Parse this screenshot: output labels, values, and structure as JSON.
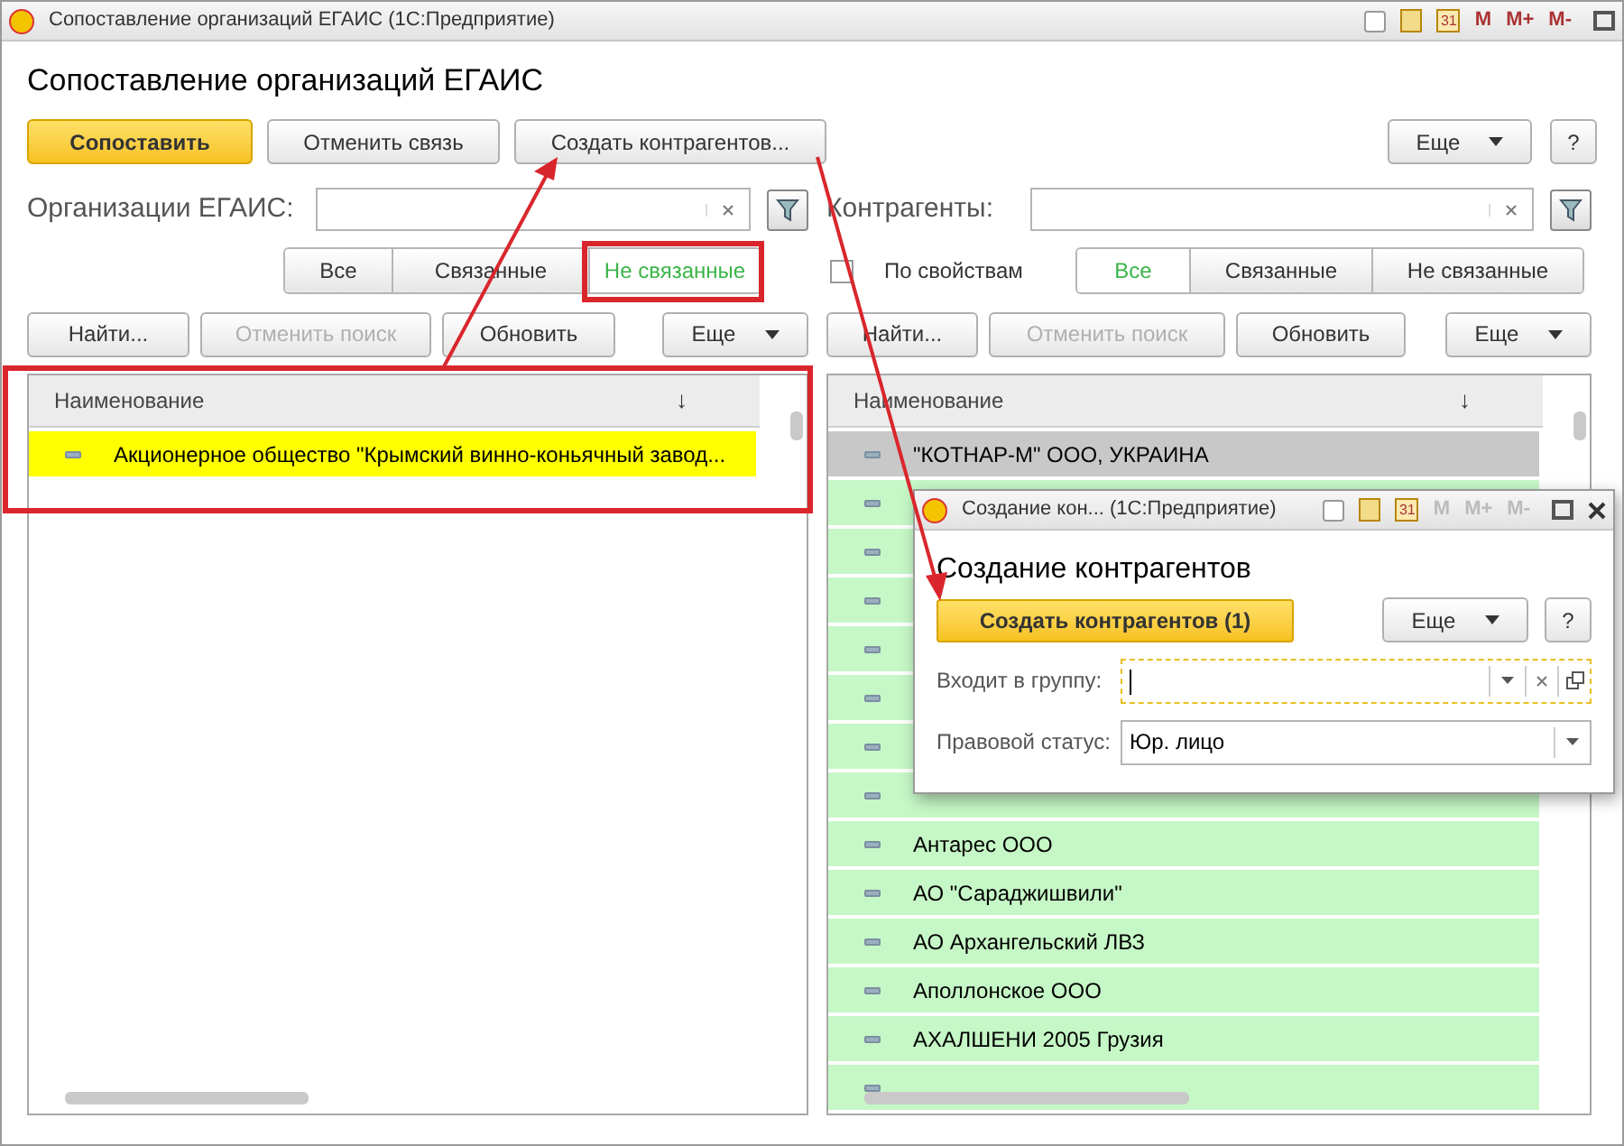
{
  "window": {
    "title": "Сопоставление организаций ЕГАИС  (1С:Предприятие)",
    "calendar_day": "31",
    "memory_buttons": [
      "M",
      "M+",
      "M-"
    ]
  },
  "form": {
    "heading": "Сопоставление организаций ЕГАИС",
    "buttons": [
      {
        "label": "Сопоставить",
        "kind": "primary"
      },
      {
        "label": "Отменить связь",
        "kind": "normal"
      },
      {
        "label": "Создать контрагентов...",
        "kind": "normal"
      }
    ],
    "more": "Еще",
    "help": "?"
  },
  "left": {
    "search_label": "Организации ЕГАИС:",
    "filter": [
      {
        "label": "Все",
        "selected": false
      },
      {
        "label": "Связанные",
        "selected": false
      },
      {
        "label": "Не связанные",
        "selected": true
      }
    ],
    "buttons": [
      {
        "label": "Найти...",
        "disabled": false
      },
      {
        "label": "Отменить поиск",
        "disabled": true
      },
      {
        "label": "Обновить",
        "disabled": false
      }
    ],
    "more": "Еще",
    "table": {
      "columns": [
        "Наименование"
      ],
      "sort_mark": "↓",
      "rows": [
        {
          "name": "Акционерное общество \"Крымский винно-коньячный завод...",
          "color": "#ffff00"
        }
      ]
    }
  },
  "right": {
    "search_label": "Контрагенты:",
    "by_properties": {
      "label": "По свойствам",
      "checked": false
    },
    "filter": [
      {
        "label": "Все",
        "selected": true
      },
      {
        "label": "Связанные",
        "selected": false
      },
      {
        "label": "Не связанные",
        "selected": false
      }
    ],
    "buttons": [
      {
        "label": "Найти...",
        "disabled": false
      },
      {
        "label": "Отменить поиск",
        "disabled": true
      },
      {
        "label": "Обновить",
        "disabled": false
      }
    ],
    "more": "Еще",
    "table": {
      "columns": [
        "Наименование"
      ],
      "sort_mark": "↓",
      "rows": [
        {
          "name": "\"КОТНАР-М\" ООО, УКРАИНА",
          "color": "#c8c8c8"
        },
        {
          "color": "#c6f7c6"
        },
        {
          "color": "#c6f7c6"
        },
        {
          "color": "#c6f7c6"
        },
        {
          "color": "#c6f7c6"
        },
        {
          "color": "#c6f7c6"
        },
        {
          "color": "#c6f7c6"
        },
        {
          "color": "#c6f7c6"
        },
        {
          "name": "Антарес ООО",
          "color": "#c6f7c6"
        },
        {
          "name": "АО \"Сараджишвили\"",
          "color": "#c6f7c6"
        },
        {
          "name": "АО Архангельский ЛВЗ",
          "color": "#c6f7c6"
        },
        {
          "name": "Аполлонское ООО",
          "color": "#c6f7c6"
        },
        {
          "name": "АХАЛШЕНИ 2005  Грузия",
          "color": "#c6f7c6"
        },
        {
          "color": "#c6f7c6"
        }
      ]
    }
  },
  "dialog": {
    "title": "Создание кон...  (1С:Предприятие)",
    "calendar_day": "31",
    "memory_buttons": [
      "M",
      "M+",
      "M-"
    ],
    "heading": "Создание контрагентов",
    "primary": "Создать контрагентов (1)",
    "more": "Еще",
    "help": "?",
    "fields": [
      {
        "label": "Входит в группу:",
        "kind": "group",
        "focused": true
      },
      {
        "label": "Правовой статус:",
        "kind": "select",
        "value": "Юр. лицо",
        "focused": false
      }
    ]
  }
}
